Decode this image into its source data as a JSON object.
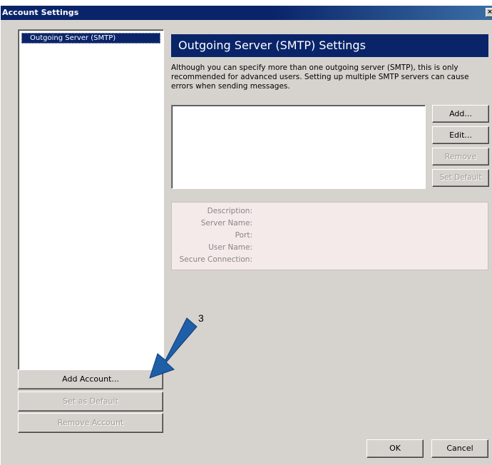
{
  "window": {
    "title": "Account Settings",
    "close_glyph": "×"
  },
  "accounts": {
    "items": [
      {
        "label": "Outgoing Server (SMTP)",
        "selected": true
      }
    ]
  },
  "account_buttons": {
    "add_account": "Add Account...",
    "set_default": "Set as Default",
    "remove_account": "Remove Account"
  },
  "smtp": {
    "title": "Outgoing Server (SMTP) Settings",
    "description": "Although you can specify more than one outgoing server (SMTP), this is only recommended for advanced users. Setting up multiple SMTP servers can cause errors when sending messages.",
    "buttons": {
      "add": "Add...",
      "edit": "Edit...",
      "remove": "Remove",
      "set_default": "Set Default"
    },
    "details": {
      "description_label": "Description:",
      "server_name_label": "Server Name:",
      "port_label": "Port:",
      "user_name_label": "User Name:",
      "secure_connection_label": "Secure Connection:"
    }
  },
  "footer": {
    "ok": "OK",
    "cancel": "Cancel"
  },
  "annotation": {
    "number": "3",
    "arrow_color": "#1f5fa8"
  },
  "colors": {
    "titlebar": "#0a246a",
    "dialog_bg": "#d6d3ce",
    "details_bg": "#f4eaea"
  }
}
